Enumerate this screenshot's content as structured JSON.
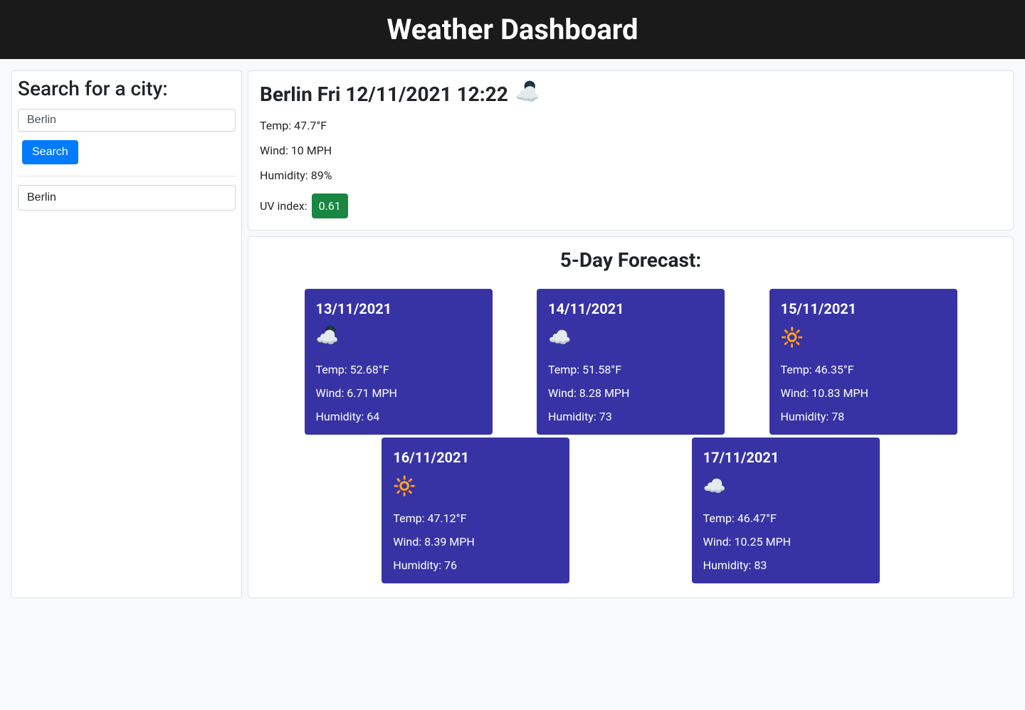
{
  "header": {
    "title": "Weather Dashboard"
  },
  "sidebar": {
    "search_label": "Search for a city:",
    "input_value": "Berlin",
    "search_button": "Search",
    "history": [
      "Berlin"
    ]
  },
  "current": {
    "title": "Berlin Fri 12/11/2021 12:22",
    "icon": "cloudy-night",
    "temp_line": "Temp: 47.7°F",
    "wind_line": "Wind: 10 MPH",
    "humidity_line": "Humidity: 89%",
    "uv_label": "UV index:",
    "uv_value": "0.61",
    "uv_color": "#198642"
  },
  "forecast": {
    "title": "5-Day Forecast:",
    "days": [
      {
        "date": "13/11/2021",
        "icon": "cloudy-night",
        "temp": "Temp: 52.68°F",
        "wind": "Wind: 6.71 MPH",
        "humidity": "Humidity: 64"
      },
      {
        "date": "14/11/2021",
        "icon": "cloud",
        "temp": "Temp: 51.58°F",
        "wind": "Wind: 8.28 MPH",
        "humidity": "Humidity: 73"
      },
      {
        "date": "15/11/2021",
        "icon": "sun",
        "temp": "Temp: 46.35°F",
        "wind": "Wind: 10.83 MPH",
        "humidity": "Humidity: 78"
      },
      {
        "date": "16/11/2021",
        "icon": "sun",
        "temp": "Temp: 47.12°F",
        "wind": "Wind: 8.39 MPH",
        "humidity": "Humidity: 76"
      },
      {
        "date": "17/11/2021",
        "icon": "cloud",
        "temp": "Temp: 46.47°F",
        "wind": "Wind: 10.25 MPH",
        "humidity": "Humidity: 83"
      }
    ]
  },
  "icons": {
    "cloudy-night": "☁️🌙",
    "cloud": "☁️",
    "sun": "🔆"
  }
}
